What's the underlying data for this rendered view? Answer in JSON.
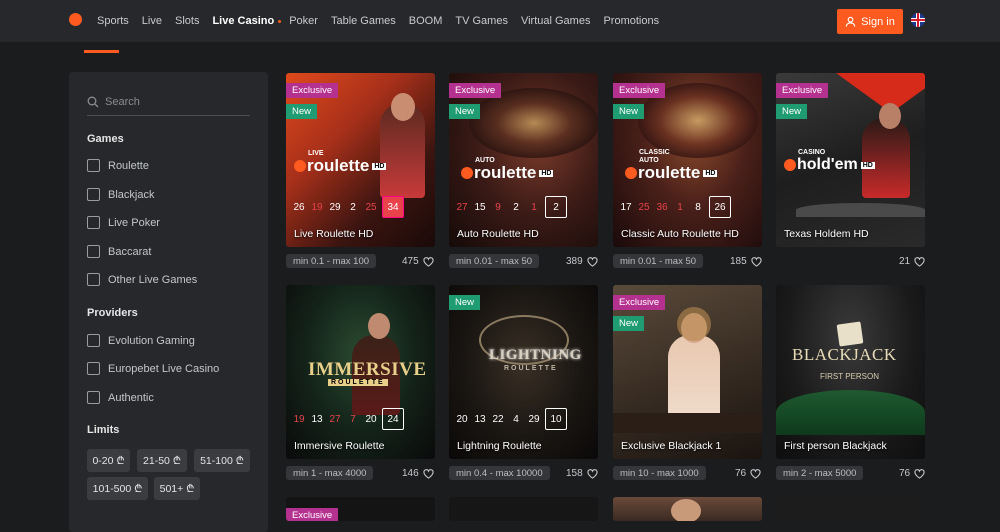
{
  "nav": {
    "items": [
      "Sports",
      "Live",
      "Slots",
      "Live Casino",
      "Poker",
      "Table Games",
      "BOOM",
      "TV Games",
      "Virtual Games",
      "Promotions"
    ],
    "active": "Live Casino",
    "sign_in": "Sign in",
    "language_icon": "uk-flag-icon",
    "accent_color": "#ff5a1f"
  },
  "sidebar": {
    "search_placeholder": "Search",
    "games_title": "Games",
    "games": [
      "Roulette",
      "Blackjack",
      "Live Poker",
      "Baccarat",
      "Other Live Games"
    ],
    "providers_title": "Providers",
    "providers": [
      "Evolution Gaming",
      "Europebet Live Casino",
      "Authentic"
    ],
    "limits_title": "Limits",
    "limits": [
      "0-20",
      "21-50",
      "51-100",
      "101-500",
      "501+"
    ],
    "currency_symbol": "₾"
  },
  "badges": {
    "exclusive": "Exclusive",
    "new": "New"
  },
  "cards": [
    {
      "title": "Live Roulette HD",
      "logo_top": "LIVE",
      "logo": "roulette",
      "logo_suffix": "HD",
      "exclusive": true,
      "new": true,
      "numbers": [
        "26",
        "19",
        "29",
        "2",
        "25"
      ],
      "number_colors": [
        "w",
        "r",
        "w",
        "w",
        "r"
      ],
      "last": "34",
      "last_red": true,
      "limit": "min 0.1 - max 100",
      "players": "475"
    },
    {
      "title": "Auto Roulette HD",
      "logo_top": "AUTO",
      "logo": "roulette",
      "logo_suffix": "HD",
      "exclusive": true,
      "new": true,
      "numbers": [
        "27",
        "15",
        "9",
        "2",
        "1"
      ],
      "number_colors": [
        "r",
        "w",
        "r",
        "w",
        "r"
      ],
      "last": "2",
      "last_red": false,
      "limit": "min 0.01 - max 50",
      "players": "389"
    },
    {
      "title": "Classic Auto Roulette HD",
      "logo_top": "CLASSIC AUTO",
      "logo": "roulette",
      "logo_suffix": "HD",
      "exclusive": true,
      "new": true,
      "numbers": [
        "17",
        "25",
        "36",
        "1",
        "8"
      ],
      "number_colors": [
        "w",
        "r",
        "r",
        "r",
        "w"
      ],
      "last": "26",
      "last_red": false,
      "limit": "min 0.01 - max 50",
      "players": "185"
    },
    {
      "title": "Texas Holdem HD",
      "logo_top": "CASINO",
      "logo": "hold'em",
      "logo_suffix": "HD",
      "exclusive": true,
      "new": true,
      "numbers": [],
      "number_colors": [],
      "last": "",
      "last_red": false,
      "limit": "",
      "players": "21"
    },
    {
      "title": "Immersive Roulette",
      "logo_top": "",
      "logo": "IMMERSIVE",
      "logo_suffix": "ROULETTE",
      "exclusive": false,
      "new": false,
      "numbers": [
        "19",
        "13",
        "27",
        "7",
        "20"
      ],
      "number_colors": [
        "r",
        "w",
        "r",
        "r",
        "w"
      ],
      "last": "24",
      "last_red": false,
      "limit": "min 1 - max 4000",
      "players": "146"
    },
    {
      "title": "Lightning Roulette",
      "logo_top": "",
      "logo": "LIGHTNING",
      "logo_suffix": "ROULETTE",
      "exclusive": false,
      "new": true,
      "numbers": [
        "20",
        "13",
        "22",
        "4",
        "29"
      ],
      "number_colors": [
        "w",
        "w",
        "w",
        "w",
        "w"
      ],
      "last": "10",
      "last_red": false,
      "limit": "min 0.4 - max 10000",
      "players": "158"
    },
    {
      "title": "Exclusive Blackjack 1",
      "logo_top": "",
      "logo": "",
      "logo_suffix": "",
      "exclusive": true,
      "new": true,
      "numbers": [],
      "number_colors": [],
      "last": "",
      "last_red": false,
      "limit": "min 10 - max 1000",
      "players": "76"
    },
    {
      "title": "First person Blackjack",
      "logo_top": "",
      "logo": "BLACKJACK",
      "logo_suffix": "FIRST PERSON",
      "exclusive": false,
      "new": false,
      "numbers": [],
      "number_colors": [],
      "last": "",
      "last_red": false,
      "limit": "min 2 - max 5000",
      "players": "76"
    }
  ],
  "row3": {
    "badge": "Exclusive"
  }
}
